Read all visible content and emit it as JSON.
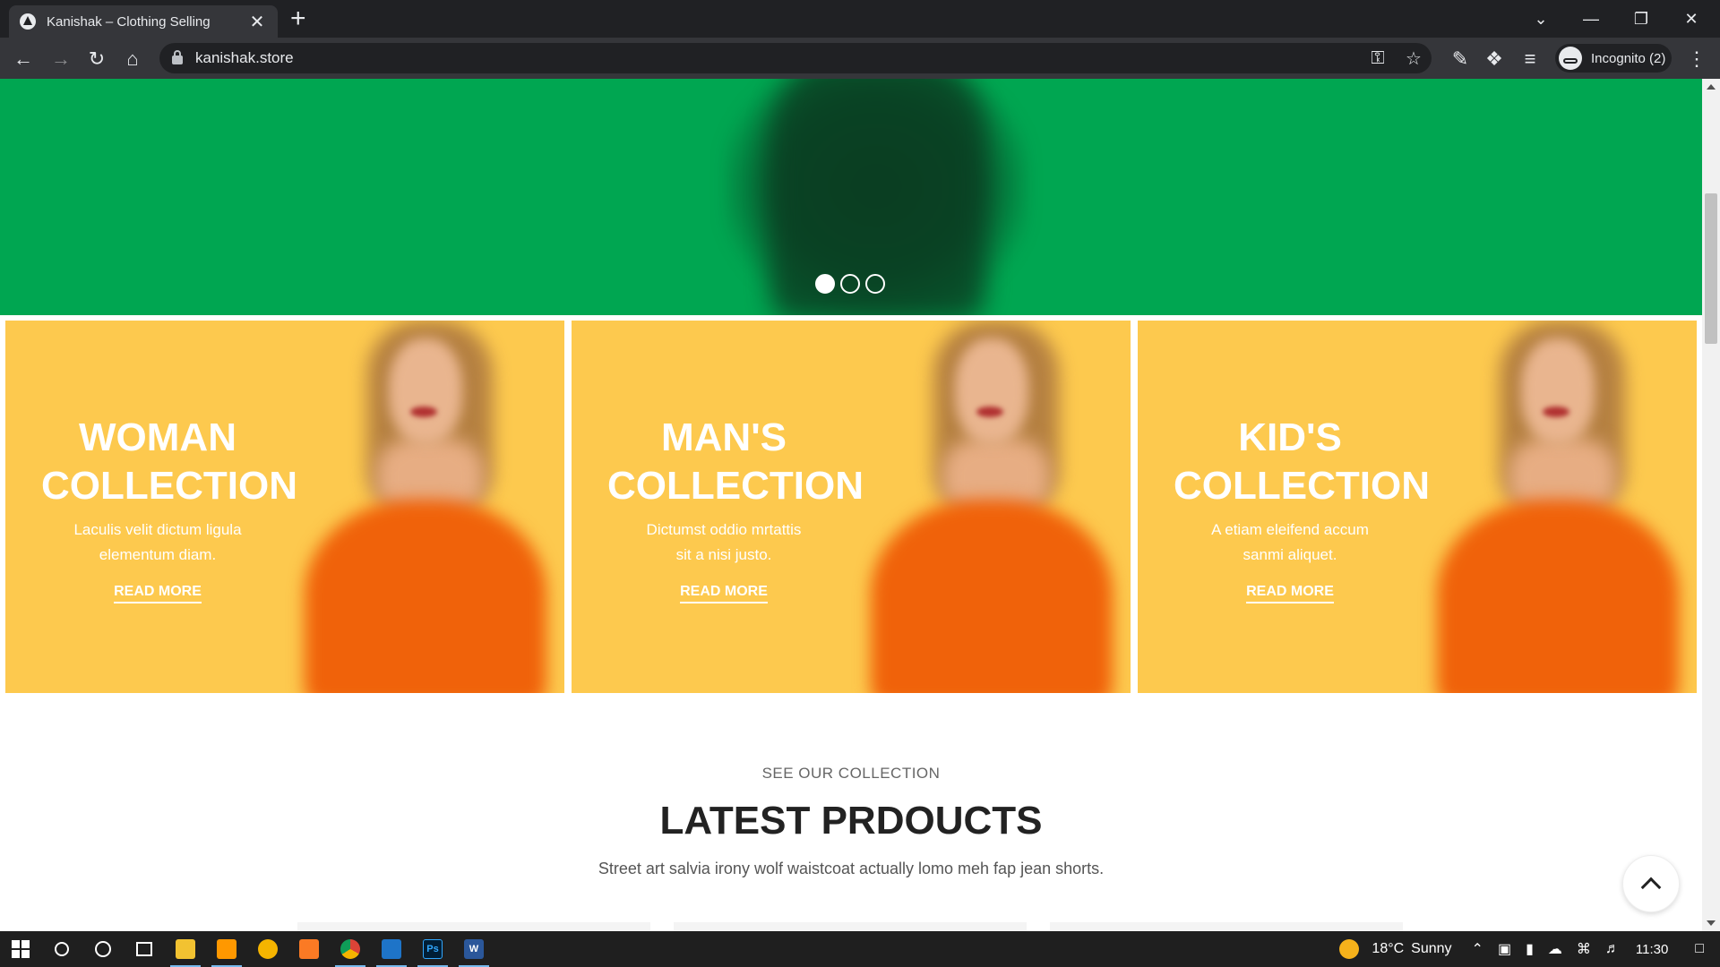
{
  "browser": {
    "tab_title": "Kanishak – Clothing Selling",
    "tab_close": "✕",
    "new_tab": "+",
    "url": "kanishak.store",
    "profile": "Incognito (2)",
    "icons": {
      "back": "←",
      "forward": "→",
      "reload": "↻",
      "home": "⌂",
      "key": "⚿",
      "star": "☆",
      "pen": "✎",
      "extensions": "❖",
      "media": "≡",
      "menu": "⋮",
      "tab_search": "⌄",
      "minimize": "—",
      "restore": "❐",
      "close": "✕"
    }
  },
  "hero": {
    "background": "#00a651",
    "slides": 3,
    "active_slide": 1
  },
  "banners": [
    {
      "title_line1": "WOMAN",
      "title_line2": "COLLECTION",
      "desc_line1": "Laculis velit dictum ligula",
      "desc_line2": "elementum diam.",
      "link": "READ MORE"
    },
    {
      "title_line1": "MAN'S",
      "title_line2": "COLLECTION",
      "desc_line1": "Dictumst oddio mrtattis",
      "desc_line2": "sit a nisi justo.",
      "link": "READ MORE"
    },
    {
      "title_line1": "KID'S",
      "title_line2": "COLLECTION",
      "desc_line1": "A etiam eleifend accum",
      "desc_line2": "sanmi aliquet.",
      "link": "READ MORE"
    }
  ],
  "latest": {
    "kicker": "SEE OUR COLLECTION",
    "title": "LATEST PRDOUCTS",
    "subtitle": "Street art salvia irony wolf waistcoat actually lomo meh fap jean shorts."
  },
  "colors": {
    "banner": "#fdc94e",
    "hero": "#00a651",
    "chrome_dark": "#202124",
    "chrome_toolbar": "#35363a"
  },
  "taskbar": {
    "weather_temp": "18°C",
    "weather_text": "Sunny",
    "time": "11:30",
    "apps": [
      "search-icon",
      "cortana-icon",
      "task-view-icon",
      "file-explorer-icon",
      "sublime-text-icon",
      "app-icon",
      "xampp-icon",
      "chrome-icon",
      "photos-icon",
      "photoshop-icon",
      "word-icon"
    ],
    "ps_label": "Ps",
    "word_label": "W"
  }
}
